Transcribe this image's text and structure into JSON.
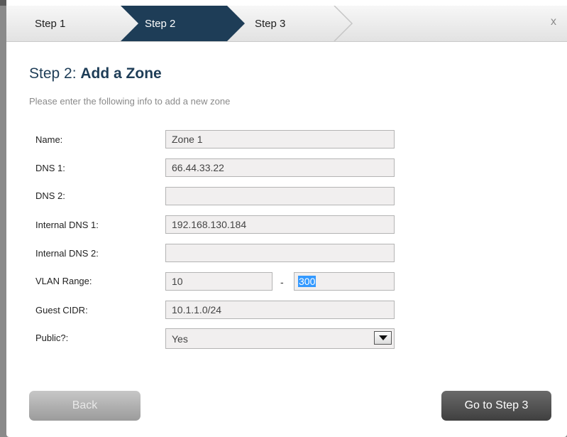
{
  "wizard": {
    "steps": [
      {
        "label": "Step 1",
        "active": false
      },
      {
        "label": "Step 2",
        "active": true
      },
      {
        "label": "Step 3",
        "active": false
      }
    ],
    "close_label": "x",
    "active_color": "#1e3d57"
  },
  "header": {
    "title_prefix": "Step 2: ",
    "title_bold": "Add a Zone",
    "subtitle": "Please enter the following info to add a new zone"
  },
  "form": {
    "name": {
      "label": "Name:",
      "value": "Zone 1"
    },
    "dns1": {
      "label": "DNS 1:",
      "value": "66.44.33.22"
    },
    "dns2": {
      "label": "DNS 2:",
      "value": ""
    },
    "internal_dns1": {
      "label": "Internal DNS 1:",
      "value": "192.168.130.184"
    },
    "internal_dns2": {
      "label": "Internal DNS 2:",
      "value": ""
    },
    "vlan": {
      "label": "VLAN Range:",
      "from": "10",
      "separator": "-",
      "to": "300"
    },
    "guest_cidr": {
      "label": "Guest CIDR:",
      "value": "10.1.1.0/24"
    },
    "public": {
      "label": "Public?:",
      "selected": "Yes"
    }
  },
  "buttons": {
    "back": "Back",
    "next": "Go to Step 3"
  }
}
